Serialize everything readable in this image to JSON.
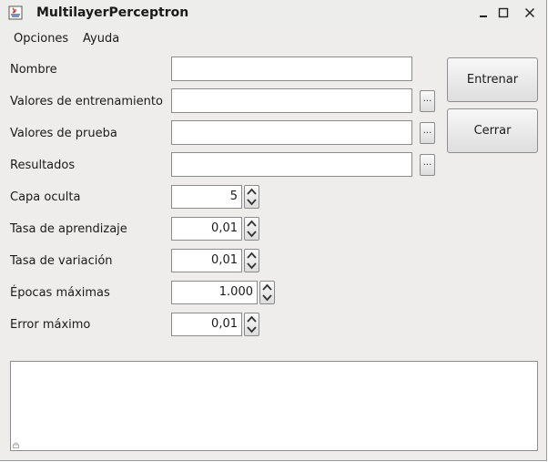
{
  "window": {
    "title": "MultilayerPerceptron",
    "controls": {
      "minimize_icon": "minimize-icon",
      "maximize_icon": "maximize-icon",
      "close_icon": "close-icon"
    }
  },
  "menu": {
    "items": [
      "Opciones",
      "Ayuda"
    ]
  },
  "fields": {
    "nombre": {
      "label": "Nombre",
      "value": ""
    },
    "entrenamiento": {
      "label": "Valores de entrenamiento",
      "value": "",
      "browse": "..."
    },
    "prueba": {
      "label": "Valores de prueba",
      "value": "",
      "browse": "..."
    },
    "resultados": {
      "label": "Resultados",
      "value": "",
      "browse": "..."
    }
  },
  "params": {
    "capa_oculta": {
      "label": "Capa oculta",
      "value": "5"
    },
    "tasa_aprendizaje": {
      "label": "Tasa de aprendizaje",
      "value": "0,01"
    },
    "tasa_variacion": {
      "label": "Tasa de variación",
      "value": "0,01"
    },
    "epocas": {
      "label": "Épocas máximas",
      "value": "1.000"
    },
    "error": {
      "label": "Error máximo",
      "value": "0,01"
    }
  },
  "buttons": {
    "train": "Entrenar",
    "close": "Cerrar"
  },
  "output": {
    "text": ""
  },
  "colors": {
    "window_bg": "#eeedec",
    "field_bg": "#ffffff",
    "border": "#8c8c8c"
  }
}
